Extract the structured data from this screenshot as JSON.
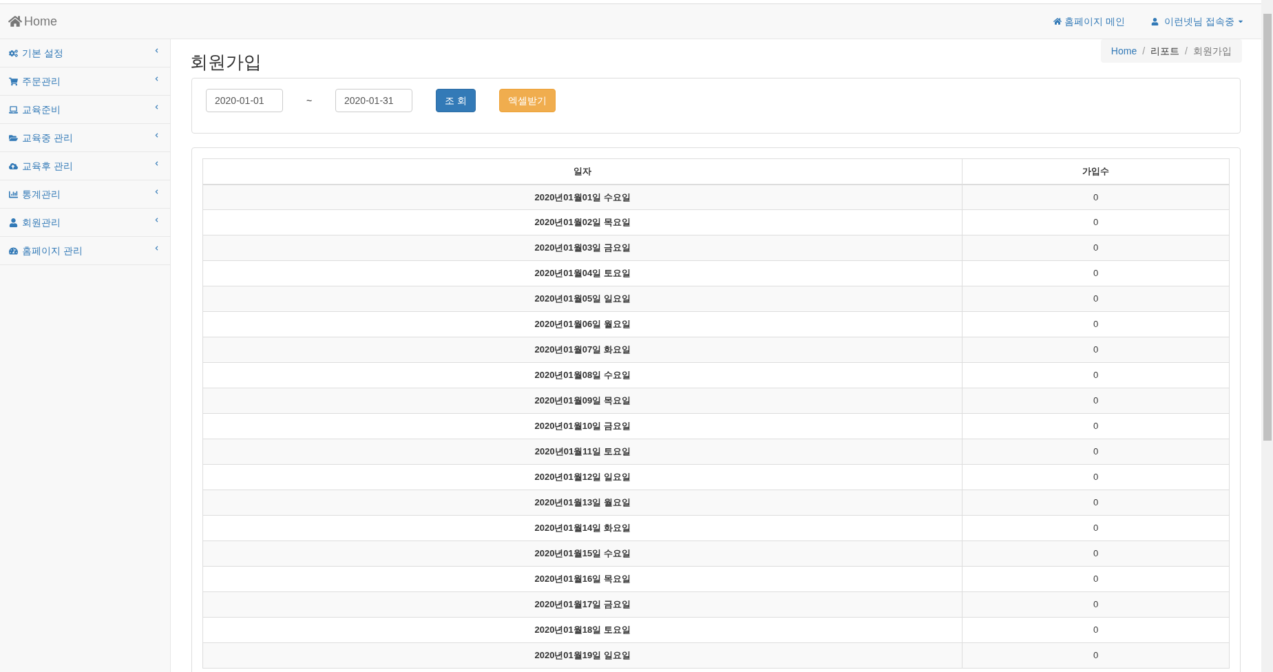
{
  "navbar": {
    "brand": "Home",
    "links": [
      {
        "kind": "home",
        "label": "홈페이지 메인"
      },
      {
        "kind": "user",
        "label": "이런넷님 접속중"
      }
    ]
  },
  "sidebar": {
    "items": [
      {
        "label": "기본 설정"
      },
      {
        "label": "주문관리"
      },
      {
        "label": "교육준비"
      },
      {
        "label": "교육중 관리"
      },
      {
        "label": "교육후 관리"
      },
      {
        "label": "통계관리"
      },
      {
        "label": "회원관리"
      },
      {
        "label": "홈페이지 관리"
      }
    ]
  },
  "page": {
    "title": "회원가입",
    "breadcrumb_separator": "/",
    "breadcrumb": [
      {
        "label": "Home",
        "kind": "link"
      },
      {
        "label": "리포트",
        "kind": "text"
      },
      {
        "label": "회원가입",
        "kind": "current"
      }
    ]
  },
  "filter": {
    "start_date": "2020-01-01",
    "separator": "~",
    "end_date": "2020-01-31",
    "buttons": [
      {
        "kind": "primary",
        "label": "조 회"
      },
      {
        "kind": "warning",
        "label": "엑셀받기"
      }
    ]
  },
  "table": {
    "columns": [
      "일자",
      "가입수"
    ],
    "rows": [
      [
        "2020년01월01일 수요일",
        "0"
      ],
      [
        "2020년01월02일 목요일",
        "0"
      ],
      [
        "2020년01월03일 금요일",
        "0"
      ],
      [
        "2020년01월04일 토요일",
        "0"
      ],
      [
        "2020년01월05일 일요일",
        "0"
      ],
      [
        "2020년01월06일 월요일",
        "0"
      ],
      [
        "2020년01월07일 화요일",
        "0"
      ],
      [
        "2020년01월08일 수요일",
        "0"
      ],
      [
        "2020년01월09일 목요일",
        "0"
      ],
      [
        "2020년01월10일 금요일",
        "0"
      ],
      [
        "2020년01월11일 토요일",
        "0"
      ],
      [
        "2020년01월12일 일요일",
        "0"
      ],
      [
        "2020년01월13일 월요일",
        "0"
      ],
      [
        "2020년01월14일 화요일",
        "0"
      ],
      [
        "2020년01월15일 수요일",
        "0"
      ],
      [
        "2020년01월16일 목요일",
        "0"
      ],
      [
        "2020년01월17일 금요일",
        "0"
      ],
      [
        "2020년01월18일 토요일",
        "0"
      ],
      [
        "2020년01월19일 일요일",
        "0"
      ]
    ]
  }
}
